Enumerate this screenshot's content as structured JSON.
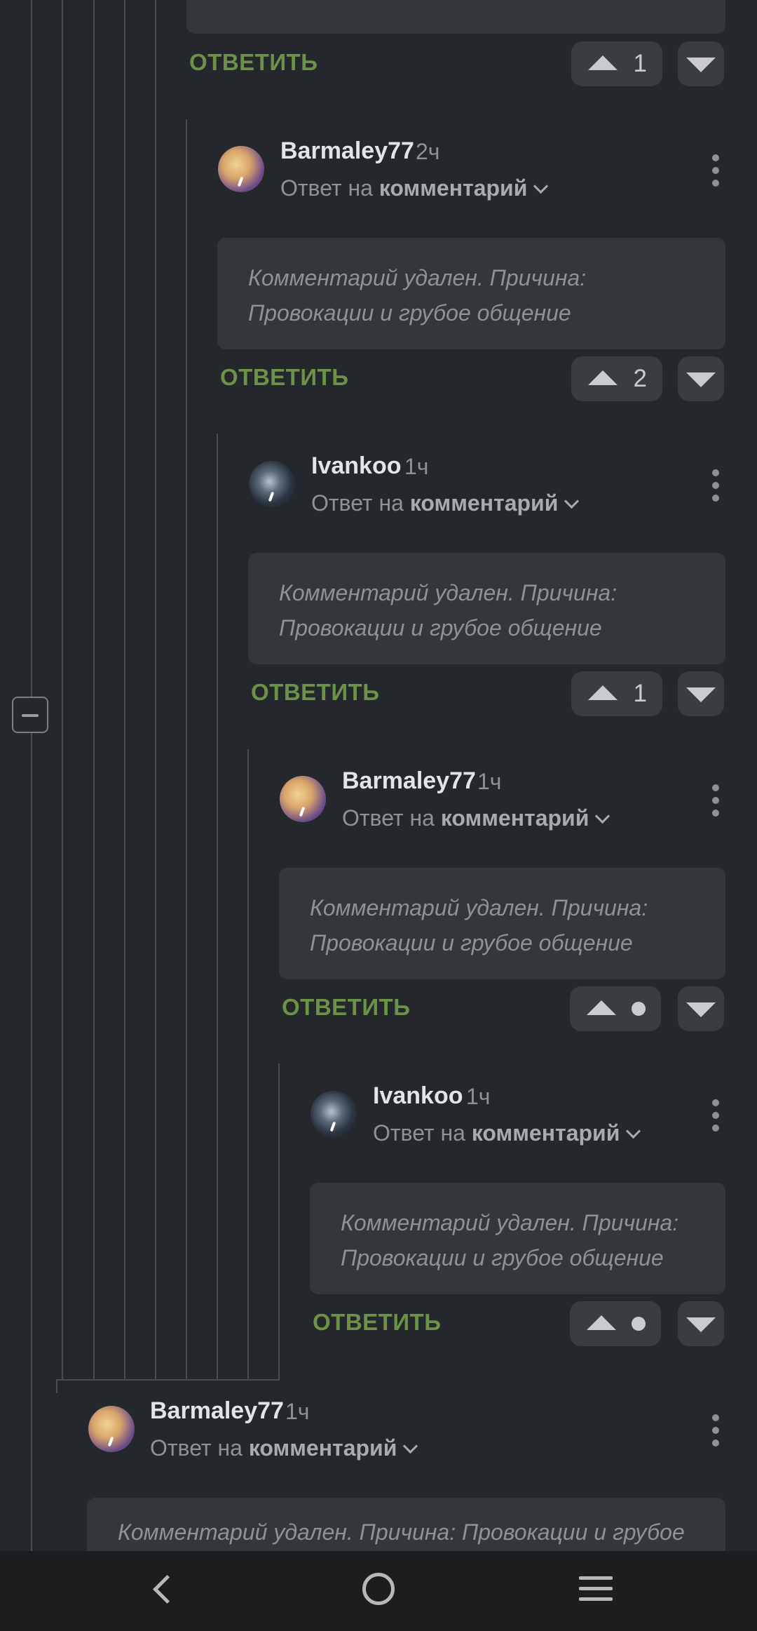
{
  "top": {
    "reply_label": "ОТВЕТИТЬ",
    "upvote_score": "1"
  },
  "comments": [
    {
      "username": "Barmaley77",
      "time": "2ч",
      "reply_prefix": "Ответ на",
      "reply_target": "комментарий",
      "text": "Комментарий удален. Причина: Провокации и грубое общение",
      "reply_label": "ОТВЕТИТЬ",
      "score": "2"
    },
    {
      "username": "Ivankoo",
      "time": "1ч",
      "reply_prefix": "Ответ на",
      "reply_target": "комментарий",
      "text": "Комментарий удален. Причина: Провокации и грубое общение",
      "reply_label": "ОТВЕТИТЬ",
      "score": "1"
    },
    {
      "username": "Barmaley77",
      "time": "1ч",
      "reply_prefix": "Ответ на",
      "reply_target": "комментарий",
      "text": "Комментарий удален. Причина: Провокации и грубое общение",
      "reply_label": "ОТВЕТИТЬ",
      "score": "dot"
    },
    {
      "username": "Ivankoo",
      "time": "1ч",
      "reply_prefix": "Ответ на",
      "reply_target": "комментарий",
      "text": "Комментарий удален. Причина: Провокации и грубое общение",
      "reply_label": "ОТВЕТИТЬ",
      "score": "dot"
    },
    {
      "username": "Barmaley77",
      "time": "1ч",
      "reply_prefix": "Ответ на",
      "reply_target": "комментарий",
      "text": "Комментарий удален. Причина: Провокации и грубое"
    }
  ],
  "icons": {
    "collapse": "minus-square-icon",
    "more": "more-vertical-icon",
    "upvote": "triangle-up-icon",
    "downvote": "triangle-down-icon",
    "back": "back-chevron-icon",
    "home": "home-circle-icon",
    "menu": "menu-lines-icon"
  },
  "colors": {
    "background": "#24272b",
    "bubble": "#33363b",
    "reply_green": "#6b9247",
    "thread_line": "#4a4e53"
  }
}
